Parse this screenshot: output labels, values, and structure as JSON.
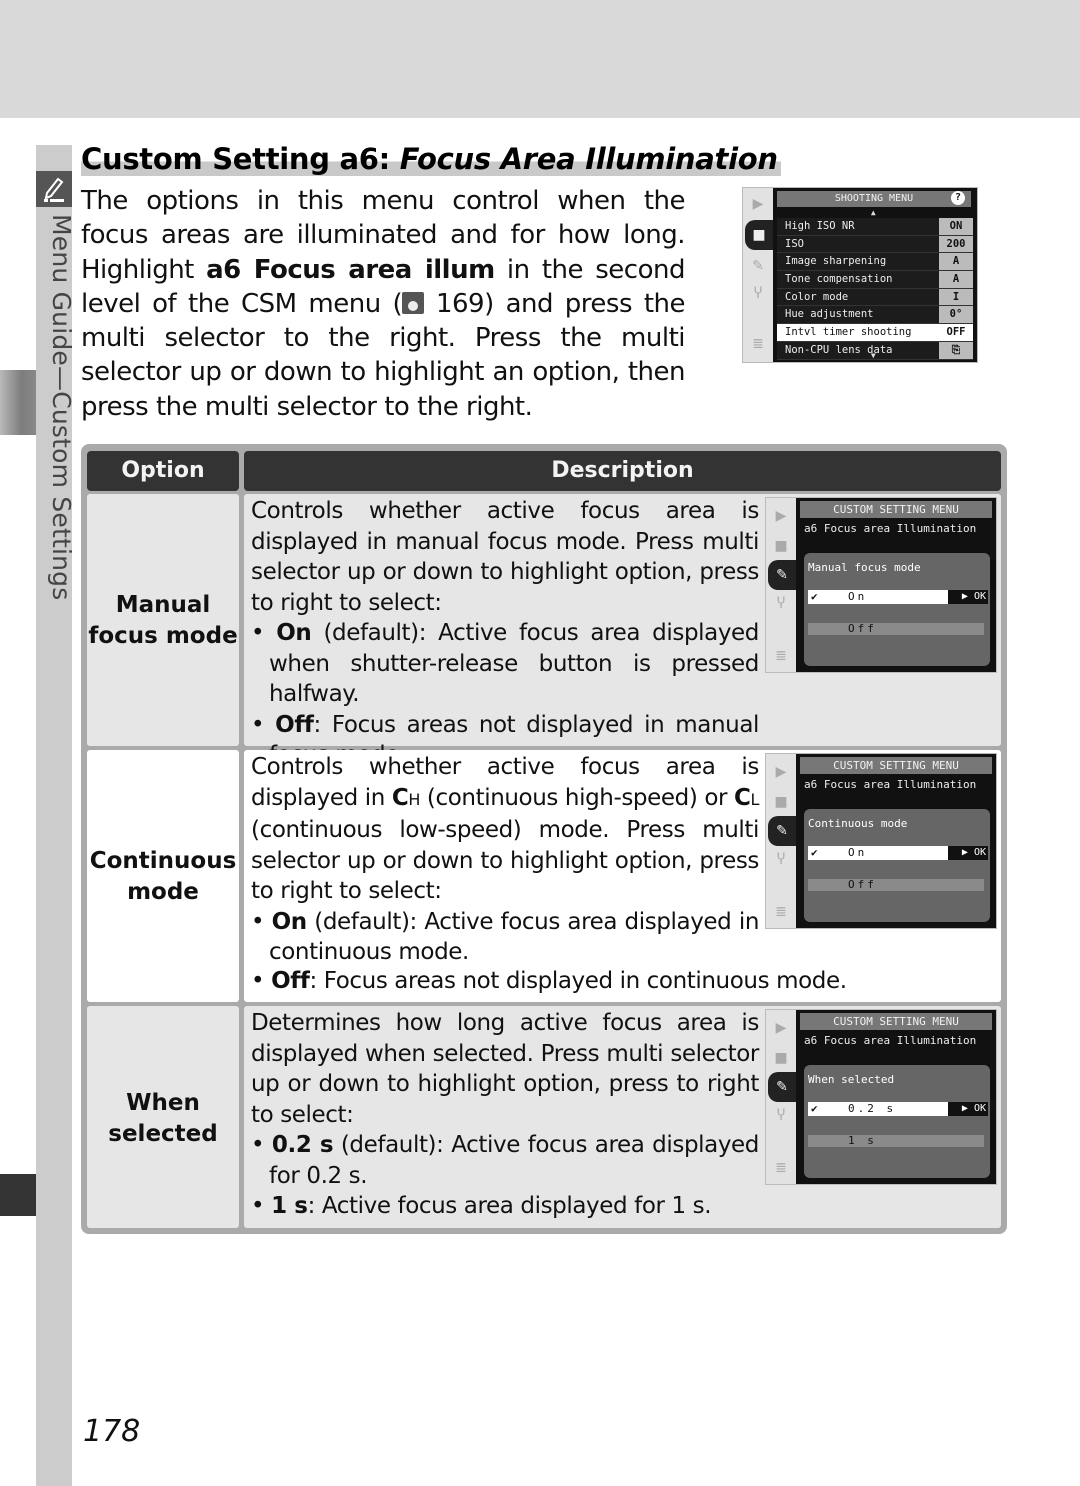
{
  "page": {
    "section_label": "Menu Guide—Custom Settings",
    "page_number": "178"
  },
  "header": {
    "title_prefix": "Custom Setting a6: ",
    "title_italic": "Focus Area Illumination"
  },
  "intro": {
    "part1": "The options in this menu control when the focus areas are illuminated and for how long.  Highlight ",
    "bold": "a6 Focus area illum",
    "part2": " in the second level of the CSM menu (",
    "ref_page": " 169)",
    "part3": " and press the multi selector to the right.  Press the multi selector up or down to highlight an option, then press the multi selector to the right."
  },
  "shooting_menu": {
    "title": "SHOOTING MENU",
    "help": "?",
    "items": [
      {
        "label": "High ISO NR",
        "value": "ON"
      },
      {
        "label": "ISO",
        "value": "200"
      },
      {
        "label": "Image sharpening",
        "value": "A"
      },
      {
        "label": "Tone compensation",
        "value": "A"
      },
      {
        "label": "Color mode",
        "value": "I"
      },
      {
        "label": "Hue adjustment",
        "value": "0°"
      },
      {
        "label": "Intvl timer shooting",
        "value": "OFF",
        "selected": true
      },
      {
        "label": "Non-CPU lens data",
        "value": "⎘"
      }
    ]
  },
  "table": {
    "headers": {
      "option": "Option",
      "description": "Description"
    },
    "rows": [
      {
        "option": [
          "Manual",
          "focus mode"
        ],
        "intro": "Controls whether active focus area is displayed in manual focus mode.  Press multi selector up or down to highlight option, press to right to select:",
        "bullets": [
          {
            "bold": "On",
            "text": " (default): Active focus area displayed when shutter-release button is pressed halfway."
          },
          {
            "bold": "Off",
            "text": ": Focus areas not displayed in manual focus mode."
          }
        ],
        "screen": {
          "head": "CUSTOM SETTING MENU",
          "sub": "a6  Focus area Illumination",
          "panel": "Manual focus mode",
          "selected": "On",
          "other": "Off",
          "ok": "▶ OK",
          "check": "✔"
        }
      },
      {
        "option": [
          "Continuous",
          "mode"
        ],
        "intro_a": "Controls whether active focus area is displayed in ",
        "ch": "C",
        "ch_sub": "H",
        "intro_b": " (continuous high-speed) or ",
        "cl": "C",
        "cl_sub": "L",
        "intro_c": " (continuous low-speed) mode.  Press multi selector up or down to highlight option, press to right to select:",
        "bullets": [
          {
            "bold": "On",
            "text": " (default): Active focus area displayed in continuous mode."
          },
          {
            "bold": "Off",
            "text": ": Focus areas not displayed in continuous mode."
          }
        ],
        "screen": {
          "head": "CUSTOM SETTING MENU",
          "sub": "a6  Focus area Illumination",
          "panel": "Continuous mode",
          "selected": "On",
          "other": "Off",
          "ok": "▶ OK",
          "check": "✔"
        }
      },
      {
        "option": [
          "When",
          "selected"
        ],
        "intro": "Determines how long active focus area is displayed when selected.  Press multi selector up or down to highlight option, press to right to select:",
        "bullets": [
          {
            "bold": "0.2 s",
            "text": " (default): Active focus area displayed for 0.2 s."
          },
          {
            "bold": "1 s",
            "text": ": Active focus area displayed for 1 s."
          }
        ],
        "screen": {
          "head": "CUSTOM SETTING MENU",
          "sub": "a6  Focus area Illumination",
          "panel": "When selected",
          "selected": "0.2 s",
          "other": "1 s",
          "ok": "▶ OK",
          "check": "✔"
        }
      }
    ]
  },
  "colors": {
    "header_bg": "#333333",
    "row_gray": "#e6e6e6",
    "row_white": "#ffffff",
    "table_frame": "#aaaaaa",
    "side_strip": "#cccccc"
  }
}
